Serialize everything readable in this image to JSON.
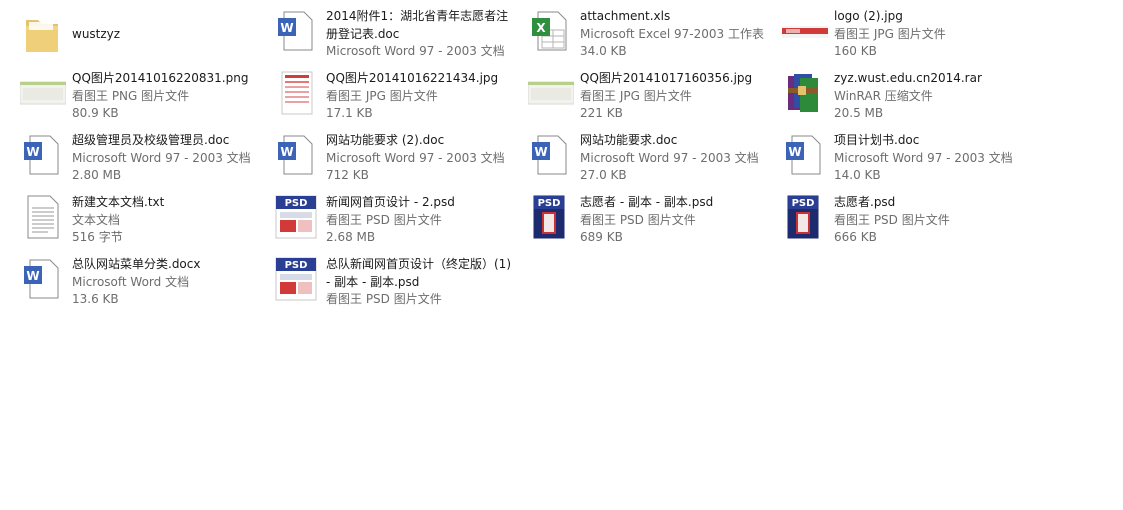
{
  "files": [
    {
      "icon": "folder-icon",
      "name": "wustzyz",
      "type": "",
      "size": ""
    },
    {
      "icon": "word-doc-icon",
      "name": "2014附件1：湖北省青年志愿者注册登记表.doc",
      "type": "Microsoft Word 97 - 2003 文档",
      "size": ""
    },
    {
      "icon": "excel-icon",
      "name": "attachment.xls",
      "type": "Microsoft Excel 97-2003 工作表",
      "size": "34.0 KB"
    },
    {
      "icon": "image-thumbnail-icon",
      "name": "logo (2).jpg",
      "type": "看图王 JPG 图片文件",
      "size": "160 KB"
    },
    {
      "icon": "image-thumbnail-icon",
      "name": "QQ图片20141016220831.png",
      "type": "看图王 PNG 图片文件",
      "size": "80.9 KB"
    },
    {
      "icon": "form-thumbnail-icon",
      "name": "QQ图片20141016221434.jpg",
      "type": "看图王 JPG 图片文件",
      "size": "17.1 KB"
    },
    {
      "icon": "image-thumbnail-icon",
      "name": "QQ图片20141017160356.jpg",
      "type": "看图王 JPG 图片文件",
      "size": "221 KB"
    },
    {
      "icon": "winrar-icon",
      "name": "zyz.wust.edu.cn2014.rar",
      "type": "WinRAR 压缩文件",
      "size": "20.5 MB"
    },
    {
      "icon": "word-doc-icon",
      "name": "超级管理员及校级管理员.doc",
      "type": "Microsoft Word 97 - 2003 文档",
      "size": "2.80 MB"
    },
    {
      "icon": "word-doc-icon",
      "name": "网站功能要求 (2).doc",
      "type": "Microsoft Word 97 - 2003 文档",
      "size": "712 KB"
    },
    {
      "icon": "word-doc-icon",
      "name": "网站功能要求.doc",
      "type": "Microsoft Word 97 - 2003 文档",
      "size": "27.0 KB"
    },
    {
      "icon": "word-doc-icon",
      "name": "项目计划书.doc",
      "type": "Microsoft Word 97 - 2003 文档",
      "size": "14.0 KB"
    },
    {
      "icon": "text-file-icon",
      "name": "新建文本文档.txt",
      "type": "文本文档",
      "size": "516 字节"
    },
    {
      "icon": "psd-icon",
      "name": "新闻网首页设计 - 2.psd",
      "type": "看图王 PSD 图片文件",
      "size": "2.68 MB"
    },
    {
      "icon": "psd-icon",
      "name": "志愿者 - 副本 - 副本.psd",
      "type": "看图王 PSD 图片文件",
      "size": "689 KB"
    },
    {
      "icon": "psd-icon",
      "name": "志愿者.psd",
      "type": "看图王 PSD 图片文件",
      "size": "666 KB"
    },
    {
      "icon": "word-doc-icon",
      "name": "总队网站菜单分类.docx",
      "type": "Microsoft Word 文档",
      "size": "13.6 KB"
    },
    {
      "icon": "psd-icon",
      "name": "总队新闻网首页设计（终定版）(1) - 副本 - 副本.psd",
      "type": "看图王 PSD 图片文件",
      "size": ""
    }
  ]
}
